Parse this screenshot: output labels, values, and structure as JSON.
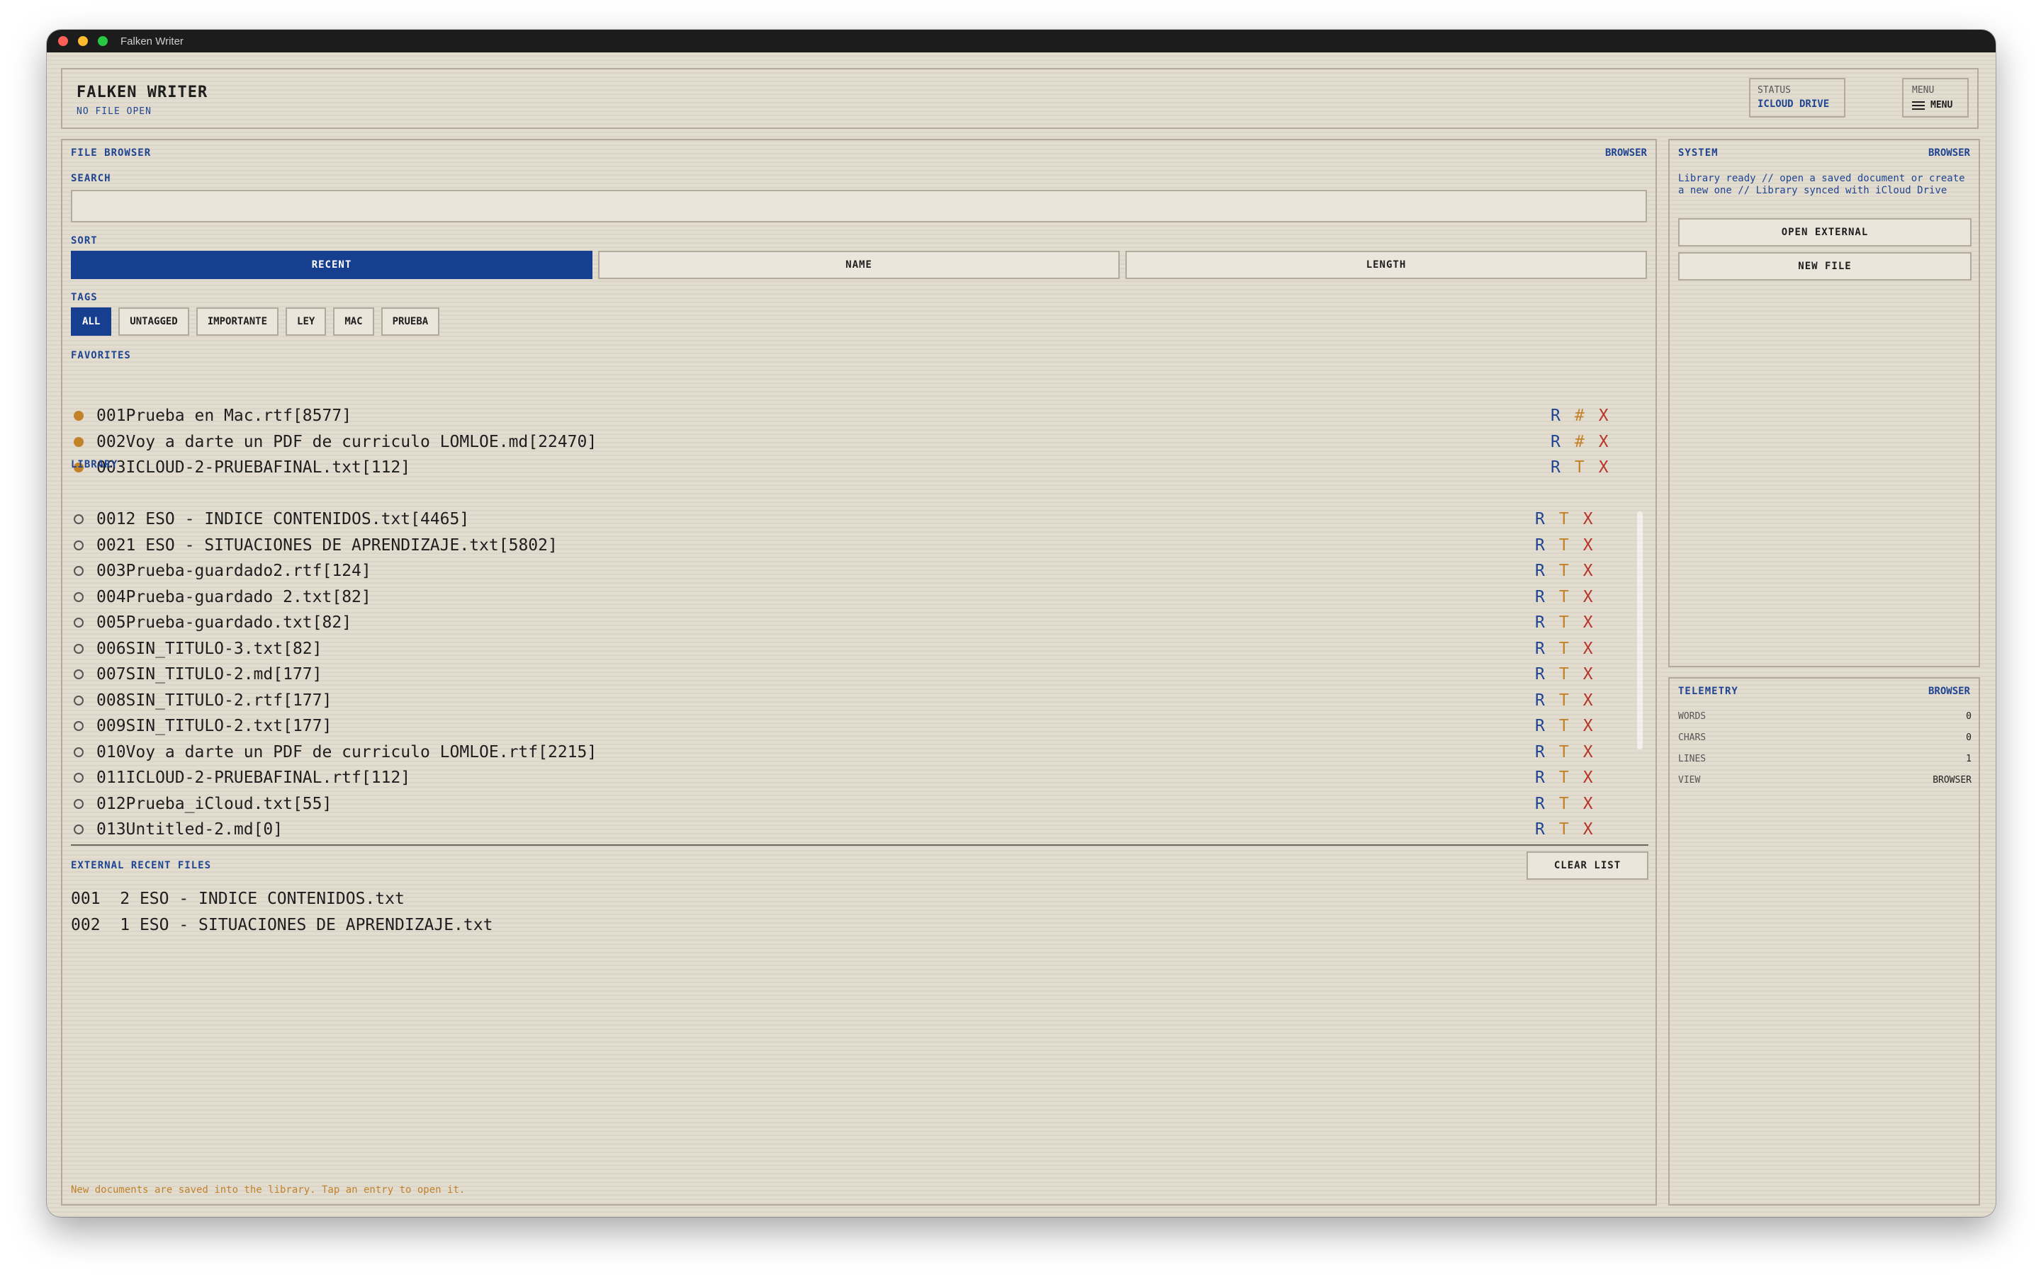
{
  "window": {
    "title": "Falken Writer"
  },
  "header": {
    "title": "FALKEN WRITER",
    "subtitle": "NO FILE OPEN",
    "status_label": "STATUS",
    "status_value": "ICLOUD DRIVE",
    "menu_small": "MENU",
    "menu_button": "MENU"
  },
  "browser": {
    "title": "FILE BROWSER",
    "corner": "BROWSER",
    "search_label": "SEARCH",
    "search_value": "",
    "search_placeholder": "",
    "sort_label": "SORT",
    "sort_options": [
      "RECENT",
      "NAME",
      "LENGTH"
    ],
    "sort_selected": "RECENT",
    "tags_label": "TAGS",
    "tags": [
      "ALL",
      "UNTAGGED",
      "IMPORTANTE",
      "LEY",
      "MAC",
      "PRUEBA"
    ],
    "tag_selected": "ALL",
    "favorites_label": "FAVORITES",
    "favorites": [
      {
        "num": "001",
        "name": "Prueba en Mac.rtf",
        "size": "[8577]",
        "actions": [
          "R",
          "#",
          "X"
        ]
      },
      {
        "num": "002",
        "name": "Voy a darte un PDF de curriculo LOMLOE.md",
        "size": "[22470]",
        "actions": [
          "R",
          "#",
          "X"
        ]
      },
      {
        "num": "003",
        "name": "ICLOUD-2-PRUEBAFINAL.txt",
        "size": "[112]",
        "actions": [
          "R",
          "T",
          "X"
        ]
      }
    ],
    "library_label": "LIBRARY",
    "library": [
      {
        "num": "001",
        "name": "2 ESO - INDICE CONTENIDOS.txt",
        "size": "[4465]",
        "actions": [
          "R",
          "T",
          "X"
        ]
      },
      {
        "num": "002",
        "name": "1 ESO - SITUACIONES DE APRENDIZAJE.txt",
        "size": "[5802]",
        "actions": [
          "R",
          "T",
          "X"
        ]
      },
      {
        "num": "003",
        "name": "Prueba-guardado2.rtf",
        "size": "[124]",
        "actions": [
          "R",
          "T",
          "X"
        ]
      },
      {
        "num": "004",
        "name": "Prueba-guardado 2.txt",
        "size": "[82]",
        "actions": [
          "R",
          "T",
          "X"
        ]
      },
      {
        "num": "005",
        "name": "Prueba-guardado.txt",
        "size": "[82]",
        "actions": [
          "R",
          "T",
          "X"
        ]
      },
      {
        "num": "006",
        "name": "SIN_TITULO-3.txt",
        "size": "[82]",
        "actions": [
          "R",
          "T",
          "X"
        ]
      },
      {
        "num": "007",
        "name": "SIN_TITULO-2.md",
        "size": "[177]",
        "actions": [
          "R",
          "T",
          "X"
        ]
      },
      {
        "num": "008",
        "name": "SIN_TITULO-2.rtf",
        "size": "[177]",
        "actions": [
          "R",
          "T",
          "X"
        ]
      },
      {
        "num": "009",
        "name": "SIN_TITULO-2.txt",
        "size": "[177]",
        "actions": [
          "R",
          "T",
          "X"
        ]
      },
      {
        "num": "010",
        "name": "Voy a darte un PDF de curriculo LOMLOE.rtf",
        "size": "[2215]",
        "actions": [
          "R",
          "T",
          "X"
        ]
      },
      {
        "num": "011",
        "name": "ICLOUD-2-PRUEBAFINAL.rtf",
        "size": "[112]",
        "actions": [
          "R",
          "T",
          "X"
        ]
      },
      {
        "num": "012",
        "name": "Prueba_iCloud.txt",
        "size": "[55]",
        "actions": [
          "R",
          "T",
          "X"
        ]
      },
      {
        "num": "013",
        "name": "Untitled-2.md",
        "size": "[0]",
        "actions": [
          "R",
          "T",
          "X"
        ]
      }
    ],
    "external_label": "EXTERNAL RECENT FILES",
    "clear_list": "CLEAR LIST",
    "external": [
      {
        "num": "001",
        "name": "2 ESO - INDICE CONTENIDOS.txt"
      },
      {
        "num": "002",
        "name": "1 ESO - SITUACIONES DE APRENDIZAJE.txt"
      }
    ],
    "footer_note": "New documents are saved into the library. Tap an entry to open it."
  },
  "system": {
    "title": "SYSTEM",
    "corner": "BROWSER",
    "message": "Library ready // open a saved document or create a new one // Library synced with iCloud Drive",
    "open_external": "OPEN EXTERNAL",
    "new_file": "NEW FILE"
  },
  "telemetry": {
    "title": "TELEMETRY",
    "corner": "BROWSER",
    "rows": [
      {
        "label": "WORDS",
        "value": "0"
      },
      {
        "label": "CHARS",
        "value": "0"
      },
      {
        "label": "LINES",
        "value": "1"
      },
      {
        "label": "VIEW",
        "value": "BROWSER"
      }
    ]
  },
  "colors": {
    "accent_blue": "#173f8f",
    "accent_orange": "#c1822a",
    "accent_red": "#b8342a",
    "background": "#e3ddd0"
  }
}
